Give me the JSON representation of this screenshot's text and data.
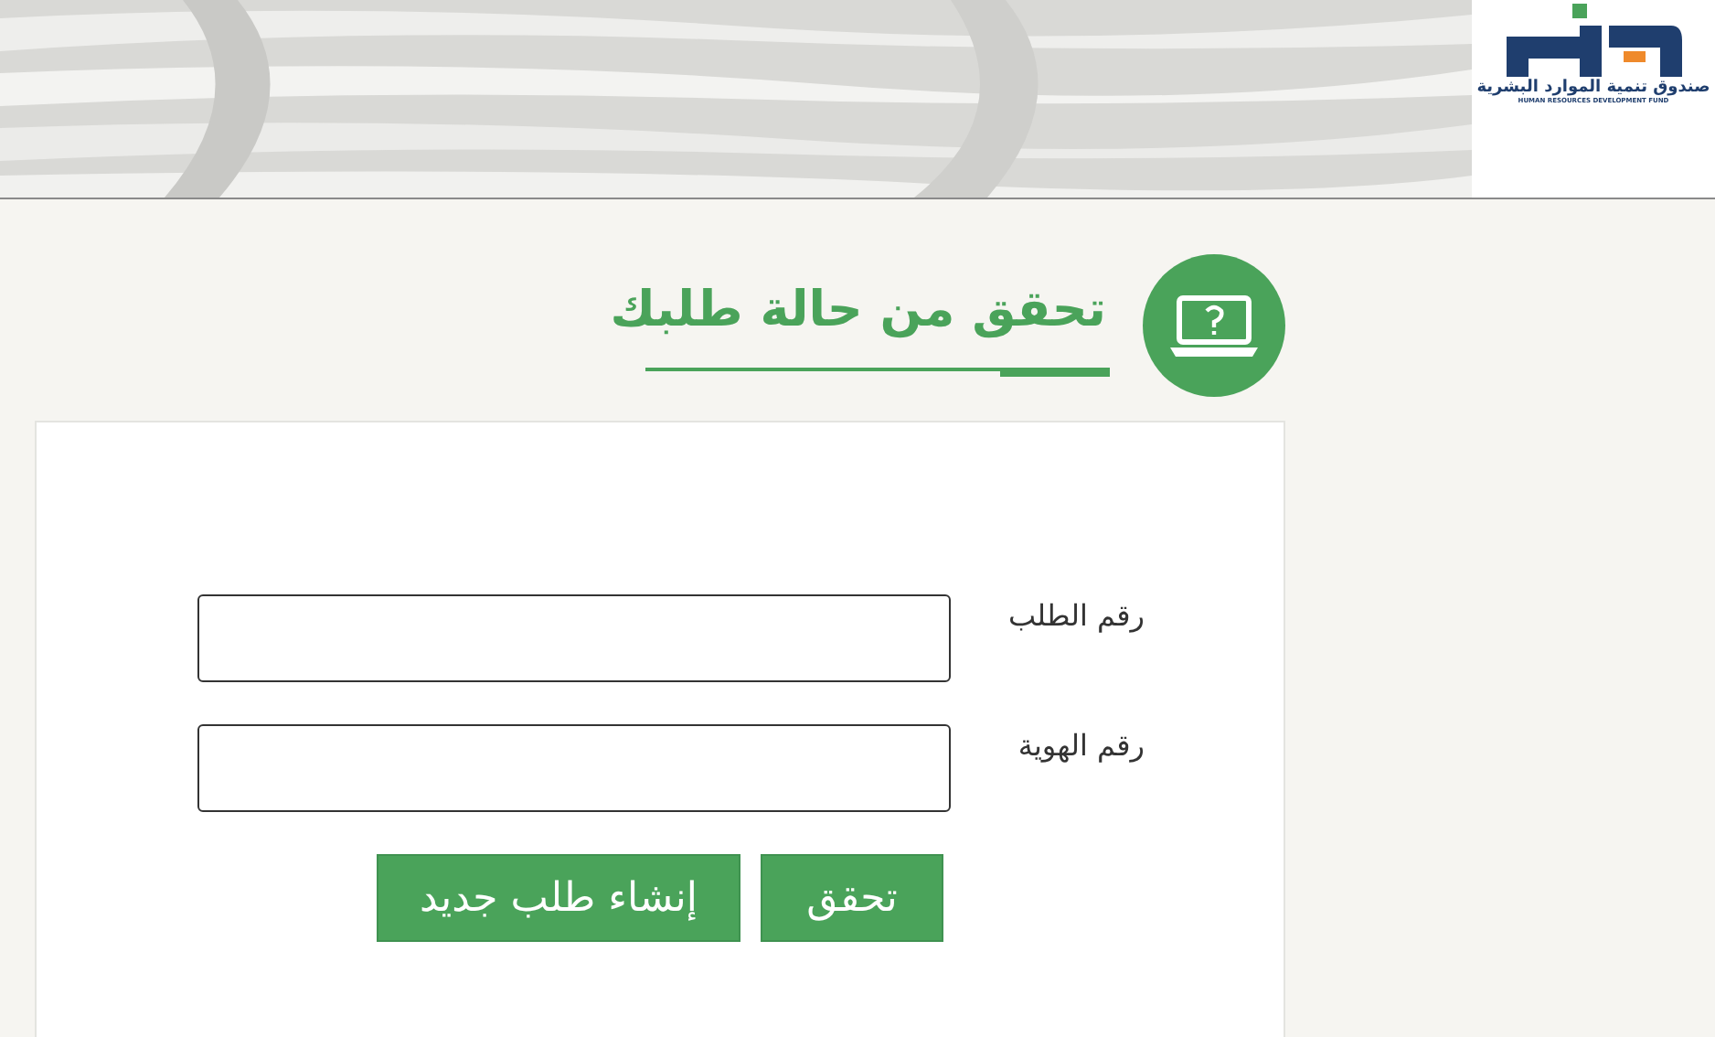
{
  "logo": {
    "name_ar": "صندوق تنمية الموارد البشرية",
    "name_en": "HUMAN RESOURCES DEVELOPMENT FUND"
  },
  "title": "تحقق من حالة طلبك",
  "form": {
    "fields": [
      {
        "label": "رقم الطلب"
      },
      {
        "label": "رقم الهوية"
      }
    ],
    "buttons": [
      {
        "label": "تحقق"
      },
      {
        "label": "إنشاء طلب جديد"
      }
    ]
  }
}
